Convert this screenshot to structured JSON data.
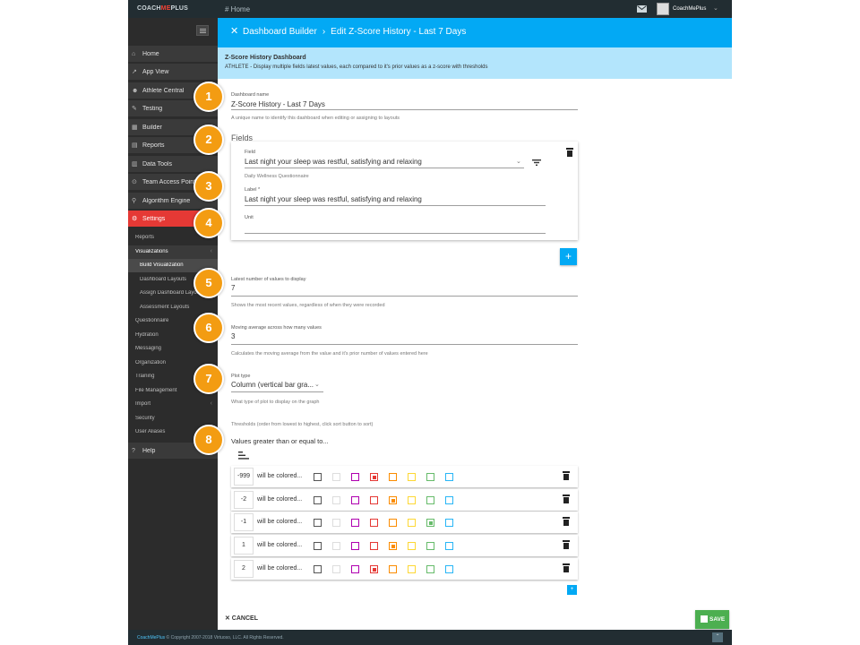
{
  "topbar": {
    "brand_pre": "COACH",
    "brand_mid": "ME",
    "brand_post": "PLUS",
    "home_label": "# Home",
    "user_name": "CoachMePlus",
    "caret": "⌄"
  },
  "sidebar": {
    "items": [
      {
        "icon": "⌂",
        "label": "Home"
      },
      {
        "icon": "↗",
        "label": "App View"
      },
      {
        "icon": "☻",
        "label": "Athlete Central"
      },
      {
        "icon": "✎",
        "label": "Testing"
      },
      {
        "icon": "▦",
        "label": "Builder"
      },
      {
        "icon": "▤",
        "label": "Reports"
      },
      {
        "icon": "▥",
        "label": "Data Tools"
      },
      {
        "icon": "⊙",
        "label": "Team Access Point"
      },
      {
        "icon": "⚲",
        "label": "Algorithm Engine"
      },
      {
        "icon": "⚙",
        "label": "Settings"
      }
    ],
    "sub_items": [
      {
        "label": "Reports"
      },
      {
        "label": "Visualizations"
      },
      {
        "label": "Build Visualization"
      },
      {
        "label": "Dashboard Layouts"
      },
      {
        "label": "Assign Dashboard Layouts"
      },
      {
        "label": "Assessment Layouts"
      },
      {
        "label": "Questionnaire"
      },
      {
        "label": "Hydration"
      },
      {
        "label": "Messaging"
      },
      {
        "label": "Organization"
      },
      {
        "label": "Training"
      },
      {
        "label": "File Management"
      },
      {
        "label": "Import"
      },
      {
        "label": "Security"
      },
      {
        "label": "User Aliases"
      }
    ],
    "help": {
      "icon": "?",
      "label": "Help"
    }
  },
  "header": {
    "close": "✕",
    "crumb_1": "Dashboard Builder",
    "separator": "›",
    "crumb_2": "Edit Z-Score History - Last 7 Days"
  },
  "info": {
    "title": "Z-Score History Dashboard",
    "description": "ATHLETE - Display multiple fields latest values, each compared to it's prior values as a z-score with thresholds"
  },
  "form": {
    "dashboard_name": {
      "label": "Dashboard name",
      "value": "Z-Score History - Last 7 Days",
      "hint": "A unique name to identify this dashboard when editing or assigning to layouts"
    },
    "fields_heading": "Fields",
    "field": {
      "field_label": "Field",
      "field_value": "Last night your sleep was restful, satisfying and relaxing",
      "field_source": "Daily Wellness Questionnaire",
      "label_label": "Label *",
      "label_value": "Last night your sleep was restful, satisfying and relaxing",
      "unit_label": "Unit",
      "unit_value": ""
    },
    "add_field": "+",
    "latest_values": {
      "label": "Latest number of values to display",
      "value": "7",
      "hint": "Shows the most recent values, regardless of when they were recorded"
    },
    "moving_average": {
      "label": "Moving average across how many values",
      "value": "3",
      "hint": "Calculates the moving average from the value and it's prior number of values entered here"
    },
    "plot_type": {
      "label": "Plot type",
      "value": "Column (vertical bar gra...",
      "hint": "What type of plot to display on the graph"
    },
    "thresholds": {
      "hint": "Thresholds (order from lowest to highest, click sort button to sort)",
      "heading": "Values greater than or equal to...",
      "row_label": "will be colored...",
      "swatch_colors": [
        "#555555",
        "#dddddd",
        "#b000b0",
        "#e53935",
        "#fb8c00",
        "#fdd835",
        "#66bb6a",
        "#29b6f6"
      ],
      "rows": [
        {
          "value": "-999",
          "selected": 3
        },
        {
          "value": "-2",
          "selected": 4
        },
        {
          "value": "-1",
          "selected": 6
        },
        {
          "value": "1",
          "selected": 4
        },
        {
          "value": "2",
          "selected": 3
        }
      ],
      "add": "+"
    }
  },
  "actions": {
    "cancel": "✕ CANCEL",
    "save": "SAVE"
  },
  "footer": {
    "brand": "CoachMePlus",
    "copyright": " © Copyright 2007-2018 Virtuoso, LLC. All Rights Reserved.",
    "up": "⌃"
  },
  "markers": [
    "1",
    "2",
    "3",
    "4",
    "5",
    "6",
    "7",
    "8"
  ]
}
